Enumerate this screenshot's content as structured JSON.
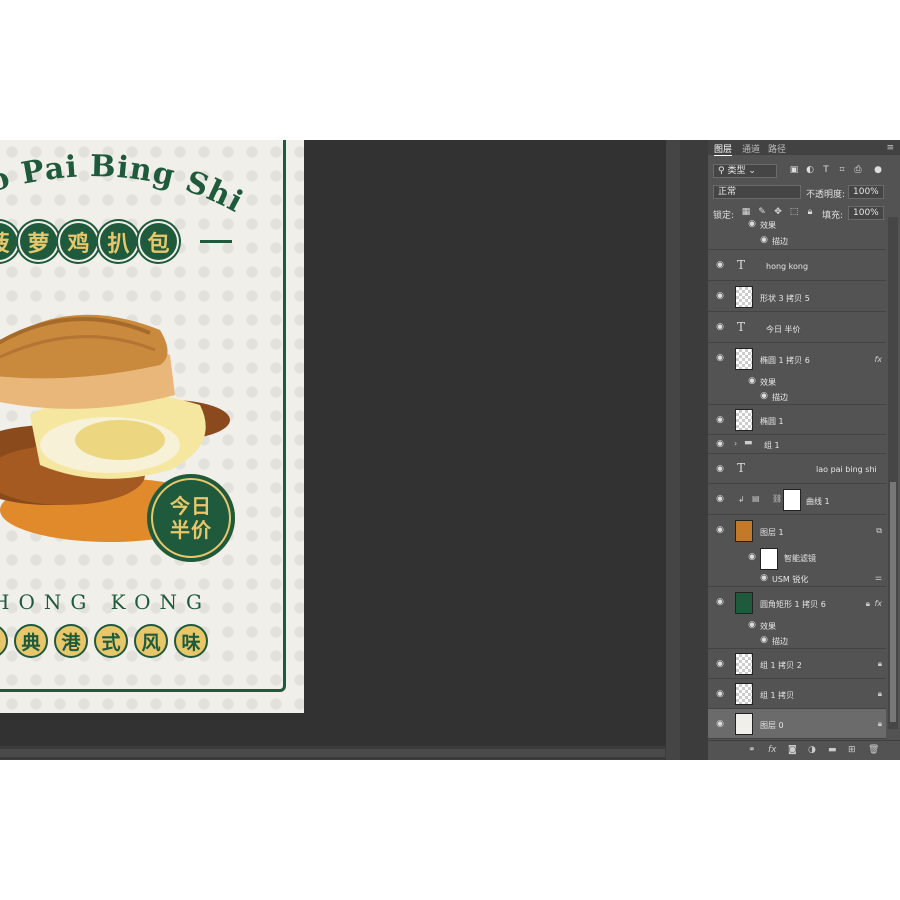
{
  "poster": {
    "arc_title": "Lao Pai Bing Shi",
    "heading_chars": [
      "菠",
      "萝",
      "鸡",
      "扒",
      "包"
    ],
    "badge_line1": "今日",
    "badge_line2": "半价",
    "hong_kong": "HONG KONG",
    "footer_chars": [
      "经",
      "典",
      "港",
      "式",
      "风",
      "味"
    ]
  },
  "panel": {
    "tabs": [
      "图层",
      "通道",
      "路径"
    ],
    "filter_kind": "类型",
    "blend_mode": "正常",
    "opacity_label": "不透明度:",
    "opacity_value": "100%",
    "lock_label": "锁定:",
    "fill_label": "填充:",
    "fill_value": "100%",
    "layers": [
      {
        "kind": "sub",
        "name": "效果"
      },
      {
        "kind": "sub2",
        "name": "描边"
      },
      {
        "kind": "text",
        "name": "hong  kong"
      },
      {
        "kind": "pixel",
        "name": "形状 3 拷贝 5"
      },
      {
        "kind": "text",
        "name": "今日 半价"
      },
      {
        "kind": "pixel",
        "name": "椭圆 1 拷贝 6",
        "fx": "fx"
      },
      {
        "kind": "sub",
        "name": "效果"
      },
      {
        "kind": "sub2",
        "name": "描边"
      },
      {
        "kind": "pixel",
        "name": "椭圆 1"
      },
      {
        "kind": "group",
        "name": "组 1"
      },
      {
        "kind": "text",
        "name": "lao pai bing shi"
      },
      {
        "kind": "curves",
        "name": "曲线 1"
      },
      {
        "kind": "smart",
        "name": "图层 1"
      },
      {
        "kind": "filter",
        "name": "智能滤镜"
      },
      {
        "kind": "sub",
        "name": "USM 锐化"
      },
      {
        "kind": "rect",
        "name": "圆角矩形 1 拷贝 6",
        "fx": "fx"
      },
      {
        "kind": "sub",
        "name": "效果"
      },
      {
        "kind": "sub2",
        "name": "描边"
      },
      {
        "kind": "pixel",
        "name": "组 1 拷贝 2"
      },
      {
        "kind": "pixel",
        "name": "组 1 拷贝"
      },
      {
        "kind": "bg",
        "name": "图层 0"
      }
    ]
  },
  "colors": {
    "accent_green": "#1f5a3d",
    "gold": "#e8c76a",
    "canvas_bg": "#323232",
    "panel_bg": "#535353"
  }
}
